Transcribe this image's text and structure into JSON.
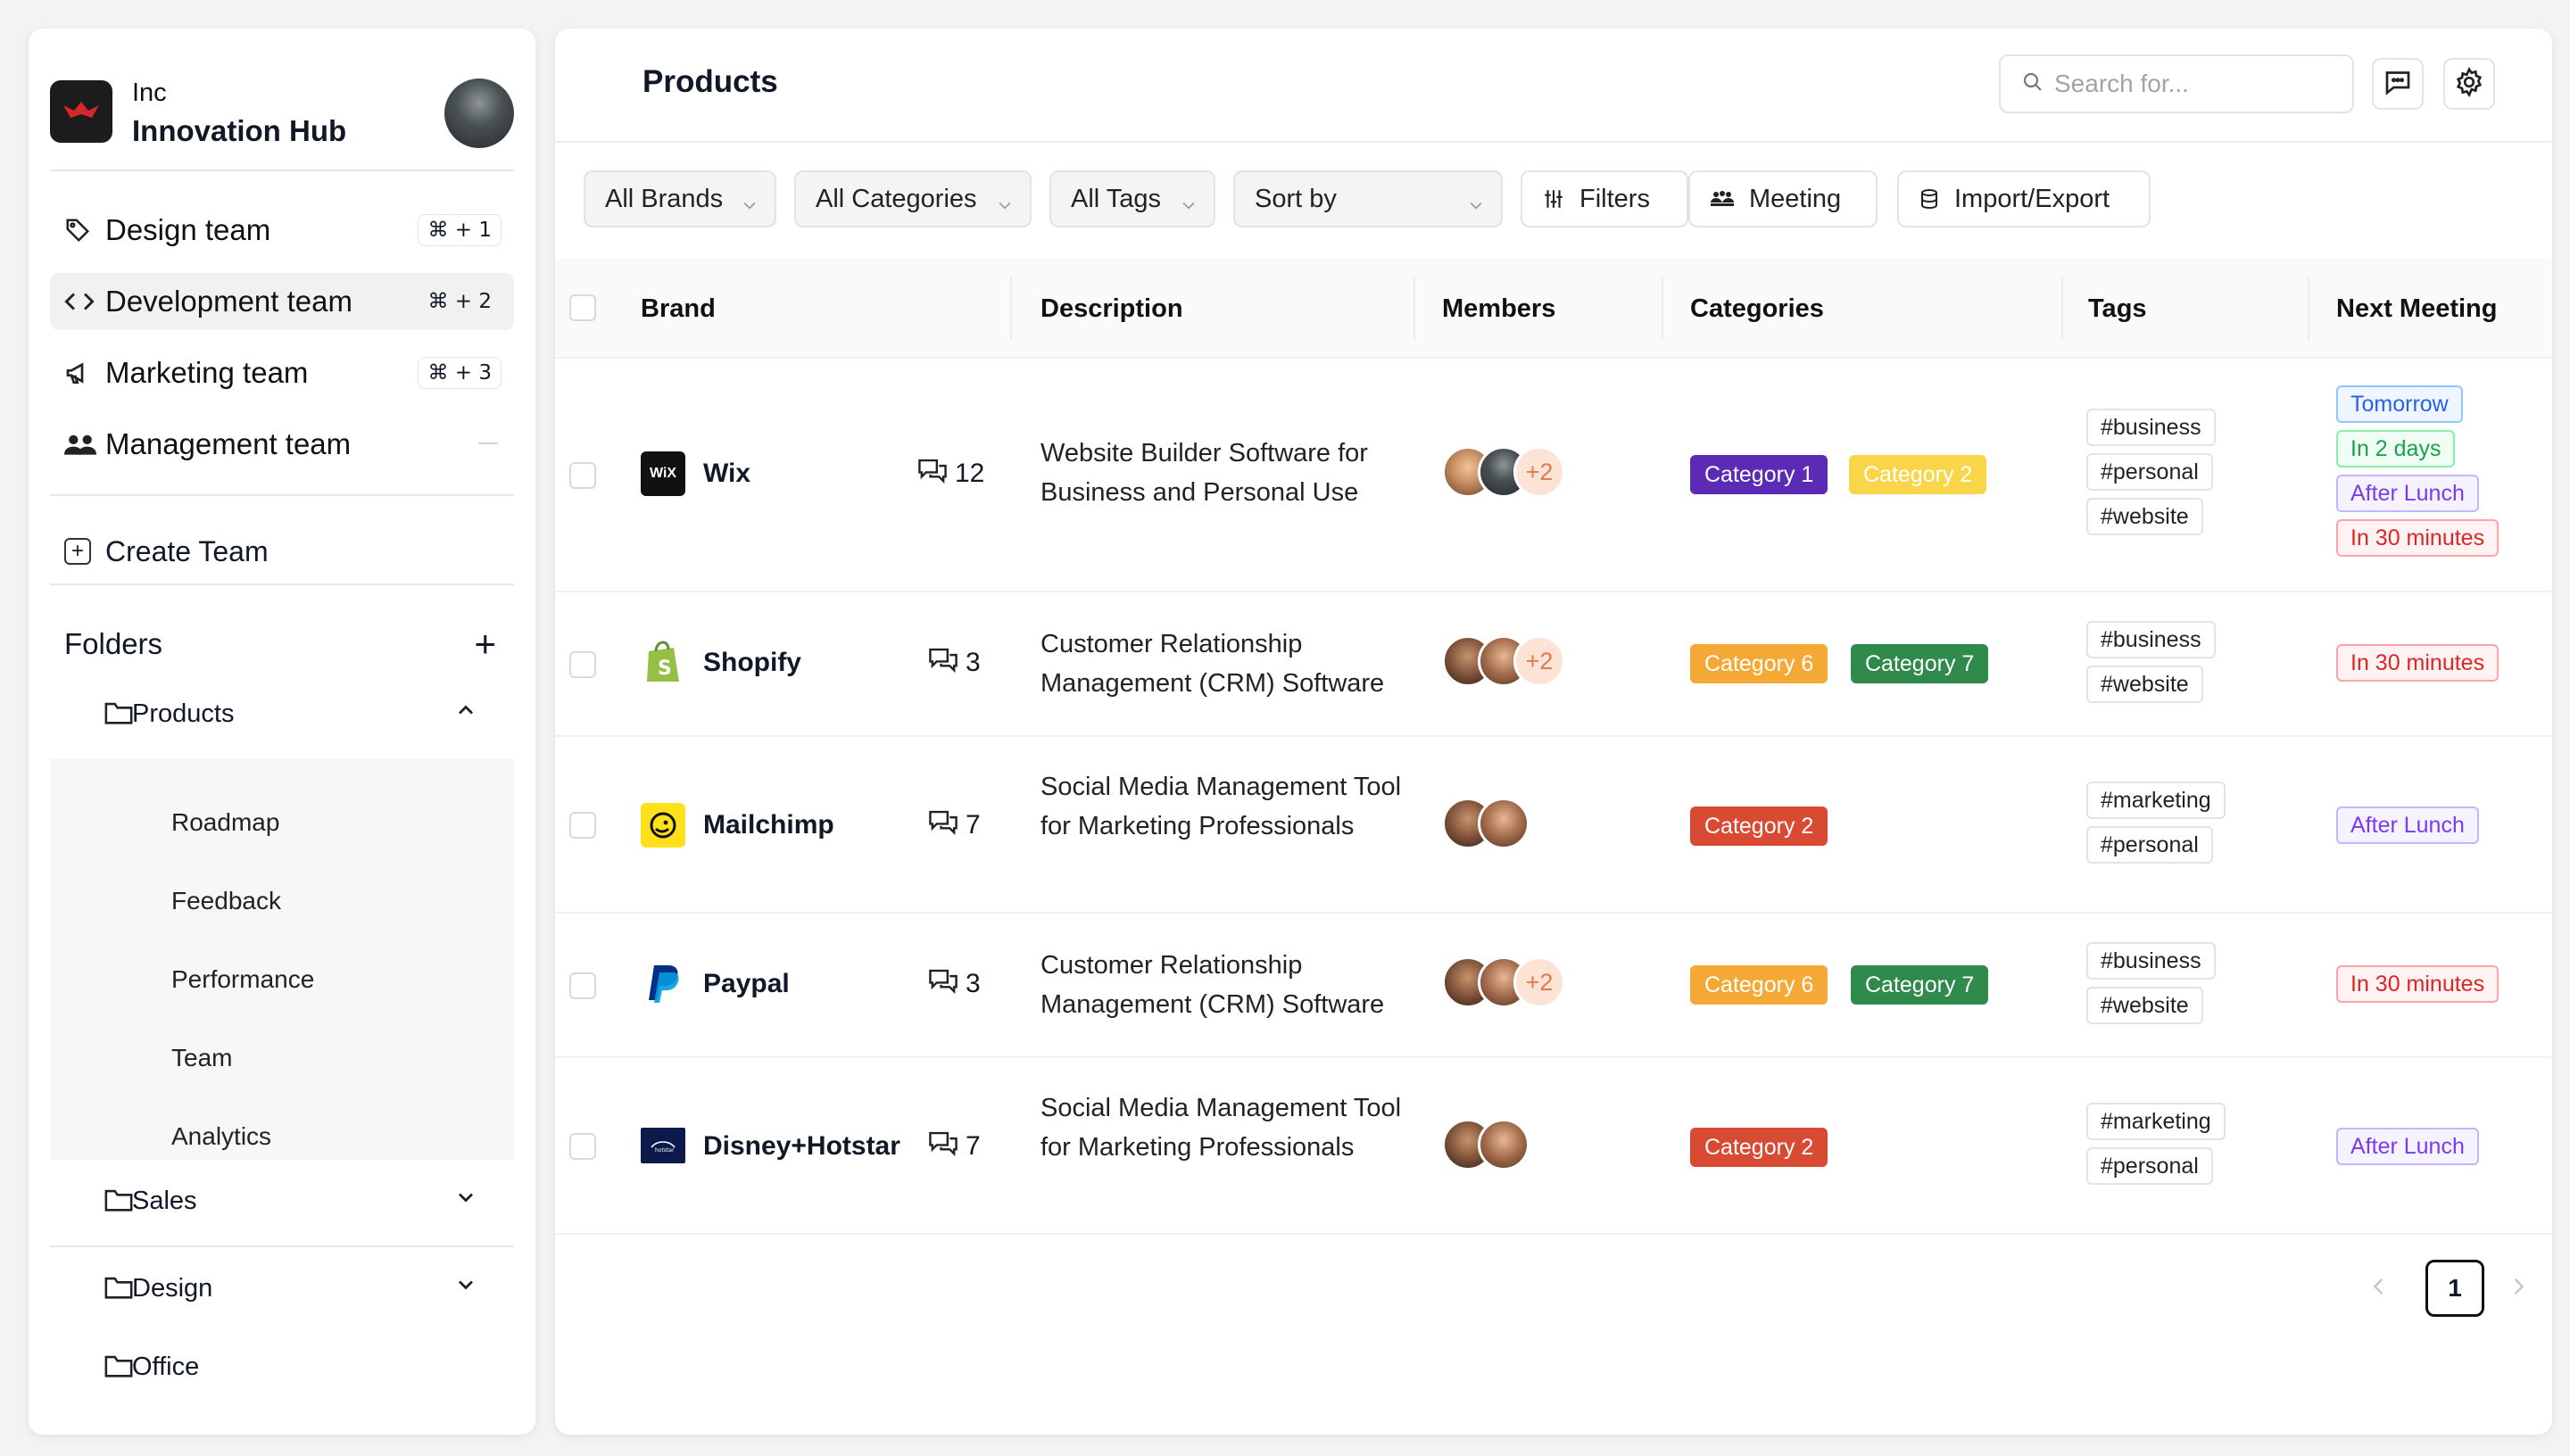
{
  "org": {
    "subtitle": "Inc",
    "name": "Innovation Hub"
  },
  "teams": [
    {
      "label": "Design team",
      "shortcut": "⌘ + 1",
      "icon": "tag-icon"
    },
    {
      "label": "Development team",
      "shortcut": "⌘ + 2",
      "icon": "code-icon"
    },
    {
      "label": "Marketing team",
      "shortcut": "⌘ + 3",
      "icon": "megaphone-icon"
    },
    {
      "label": "Management team",
      "shortcut": "",
      "icon": "users-icon"
    }
  ],
  "create_team": "Create Team",
  "folders": {
    "title": "Folders",
    "items": [
      {
        "label": "Products",
        "expanded": true,
        "children": [
          "Roadmap",
          "Feedback",
          "Performance",
          "Team",
          "Analytics"
        ]
      },
      {
        "label": "Sales",
        "expanded": false
      },
      {
        "label": "Design",
        "expanded": false
      },
      {
        "label": "Office",
        "expanded": false
      }
    ]
  },
  "main": {
    "title": "Products",
    "search_placeholder": "Search for...",
    "filters": {
      "brands": "All Brands",
      "categories": "All Categories",
      "tags": "All Tags",
      "sort": "Sort by",
      "filters_btn": "Filters",
      "meeting_btn": "Meeting",
      "import_btn": "Import/Export"
    },
    "columns": [
      "Brand",
      "Description",
      "Members",
      "Categories",
      "Tags",
      "Next Meeting"
    ],
    "rows": [
      {
        "brand": "Wix",
        "comments": "12",
        "description": "Website Builder Software for Business and Personal Use",
        "members_more": "+2",
        "categories": [
          "Category 1",
          "Category 2"
        ],
        "tags": [
          "#business",
          "#personal",
          "#website"
        ],
        "meetings": [
          "Tomorrow",
          "In 2 days",
          "After Lunch",
          "In 30 minutes"
        ]
      },
      {
        "brand": "Shopify",
        "comments": "3",
        "description": "Customer Relationship Management (CRM) Software",
        "members_more": "+2",
        "categories": [
          "Category 6",
          "Category 7"
        ],
        "tags": [
          "#business",
          "#website"
        ],
        "meetings": [
          "In 30 minutes"
        ]
      },
      {
        "brand": "Mailchimp",
        "comments": "7",
        "description": "Social Media Management Tool for Marketing Professionals",
        "members_more": "",
        "categories": [
          "Category 2"
        ],
        "tags": [
          "#marketing",
          "#personal"
        ],
        "meetings": [
          "After Lunch"
        ]
      },
      {
        "brand": "Paypal",
        "comments": "3",
        "description": "Customer Relationship Management (CRM) Software",
        "members_more": "+2",
        "categories": [
          "Category 6",
          "Category 7"
        ],
        "tags": [
          "#business",
          "#website"
        ],
        "meetings": [
          "In 30 minutes"
        ]
      },
      {
        "brand": "Disney+Hotstar",
        "comments": "7",
        "description": "Social Media Management Tool for Marketing Professionals",
        "members_more": "",
        "categories": [
          "Category 2"
        ],
        "tags": [
          "#marketing",
          "#personal"
        ],
        "meetings": [
          "After Lunch"
        ]
      }
    ],
    "page": "1"
  },
  "colors": {
    "category_1": "#5b2bb5",
    "category_2_light": "#f9d54a",
    "category_2_red": "#d94a32",
    "category_6": "#f4a936",
    "category_7": "#2f8a4c",
    "meet_blue": "#3b82f6",
    "meet_green": "#22a34a",
    "meet_purple": "#7c3aed",
    "meet_red": "#dc2626"
  }
}
